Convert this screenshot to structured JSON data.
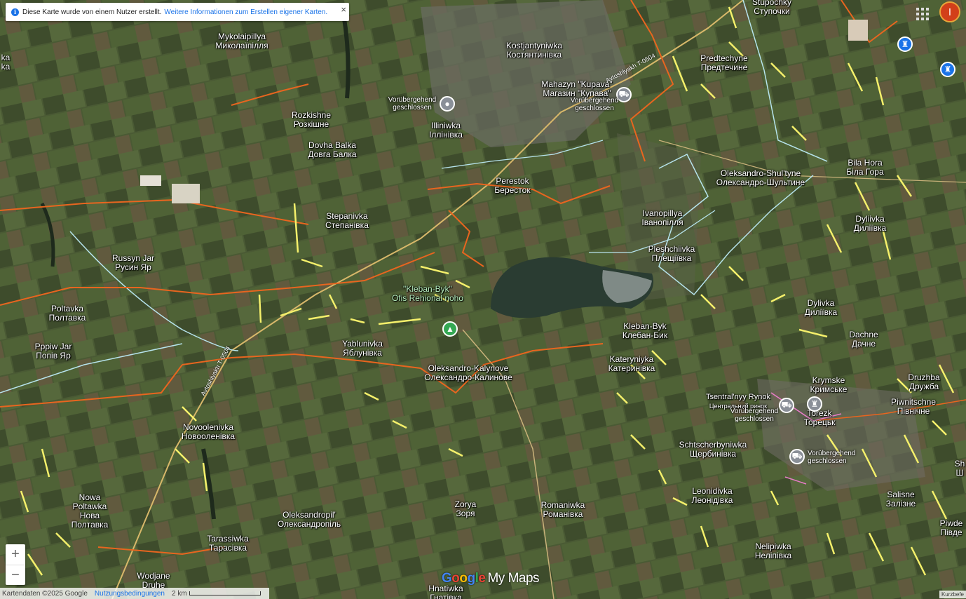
{
  "banner": {
    "text": "Diese Karte wurde von einem Nutzer erstellt.",
    "link": "Weitere Informationen zum Erstellen eigener Karten.",
    "close": "×"
  },
  "header": {
    "avatar_letter": "I"
  },
  "places": [
    {
      "name": "Stupochky",
      "alt": "Ступочки"
    },
    {
      "name": "Mykolaipillya",
      "alt": "Миколаїпілля"
    },
    {
      "name": "Kostjantyniwka",
      "alt": "Костянтинівка"
    },
    {
      "name": "Predtechyne",
      "alt": "Предтечине"
    },
    {
      "name": "Mahazyn \"Kupava\"",
      "alt": "Магазин \"Купава\""
    },
    {
      "name": "Rozkishne",
      "alt": "Розкішне"
    },
    {
      "name": "Illiniwka",
      "alt": "Іллінівка"
    },
    {
      "name": "Dovha Balka",
      "alt": "Довга Балка"
    },
    {
      "name": "Perestok",
      "alt": "Бересток"
    },
    {
      "name": "Oleksandro-Shul'tyne",
      "alt": "Олександро-Шультине"
    },
    {
      "name": "Bila Hora",
      "alt": "Біла Гора"
    },
    {
      "name": "Stepanivka",
      "alt": "Степанівка"
    },
    {
      "name": "Ivanopillya",
      "alt": "Іванопілля"
    },
    {
      "name": "Dyliivka",
      "alt": "Диліївка"
    },
    {
      "name": "Pleshchiivka",
      "alt": "Плещіївка"
    },
    {
      "name": "Russyn Jar",
      "alt": "Русин Яр"
    },
    {
      "name": "\"Kleban-Byk\"",
      "alt": "Ofis Rehional noho"
    },
    {
      "name": "Poltavka",
      "alt": "Полтавка"
    },
    {
      "name": "Dylivka",
      "alt": "Диліївка"
    },
    {
      "name": "Kleban-Byk",
      "alt": "Клебан-Бик"
    },
    {
      "name": "Dachne",
      "alt": "Дачне"
    },
    {
      "name": "Yablunivka",
      "alt": "Яблунівка"
    },
    {
      "name": "Pppiw Jar",
      "alt": "Попів Яр"
    },
    {
      "name": "Kateryniyka",
      "alt": "Катеринівка"
    },
    {
      "name": "Oleksandro-Kalynove",
      "alt": "Олександро-Калинове"
    },
    {
      "name": "Druzhba",
      "alt": "Дружба"
    },
    {
      "name": "Krymske",
      "alt": "Кримське"
    },
    {
      "name": "Tsentral'nyy Rynok",
      "alt": "Центральний ринок"
    },
    {
      "name": "Torezk",
      "alt": "Торецьк"
    },
    {
      "name": "Piwnitschne",
      "alt": "Північне"
    },
    {
      "name": "Novoolenivka",
      "alt": "Новоолeнівка"
    },
    {
      "name": "Schtscherbyniwka",
      "alt": "Щербинівка"
    },
    {
      "name": "Leonidivka",
      "alt": "Леонідівка"
    },
    {
      "name": "Salisne",
      "alt": "Залізне"
    },
    {
      "name": "Nowa Poltawka",
      "alt": "Нова Полтавка"
    },
    {
      "name": "Zorya",
      "alt": "Зоря"
    },
    {
      "name": "Romaniwka",
      "alt": "Романівка"
    },
    {
      "name": "Oleksandropil'",
      "alt": "Олександропіль"
    },
    {
      "name": "Piwde",
      "alt": "Півде"
    },
    {
      "name": "Tarassiwka",
      "alt": "Тарасівка"
    },
    {
      "name": "Nelipiwka",
      "alt": "Неліпівка"
    },
    {
      "name": "Wodjane",
      "alt": "Druhe"
    },
    {
      "name": "Hnatiwka",
      "alt": "Гнатівка"
    },
    {
      "name": "ka",
      "alt": "ka"
    },
    {
      "name": "Sh",
      "alt": "Ш"
    }
  ],
  "pois": [
    {
      "text": "Vorübergehend geschlossen",
      "icon": "pin-icon"
    },
    {
      "text": "Vorübergehend geschlossen",
      "icon": "shopping-cart-icon"
    },
    {
      "text": "Vorübergehend geschlossen",
      "icon": "shopping-cart-icon"
    },
    {
      "text": "Vorübergehend geschlossen",
      "icon": "shopping-cart-icon"
    }
  ],
  "roads": [
    "Avtoshlyakh T-0504",
    "Avtoshlyakh T-0504"
  ],
  "map_controls": {
    "zoom_in": "+",
    "zoom_out": "−"
  },
  "footer": {
    "attribution": "Kartendaten ©2025 Google",
    "terms": "Nutzungsbedingungen",
    "scale": "2 km",
    "shortcuts": "Kurzbefe"
  },
  "brand": {
    "g1": "G",
    "g2": "o",
    "g3": "o",
    "g4": "g",
    "g5": "l",
    "g6": "e",
    "product": "My Maps"
  },
  "colors": {
    "frontline_orange": "#e8651f",
    "positions_yellow": "#f5f06b",
    "water_cyan": "#b6e3ec",
    "marker_blue": "#1a73e8",
    "marker_green": "#34a853"
  }
}
